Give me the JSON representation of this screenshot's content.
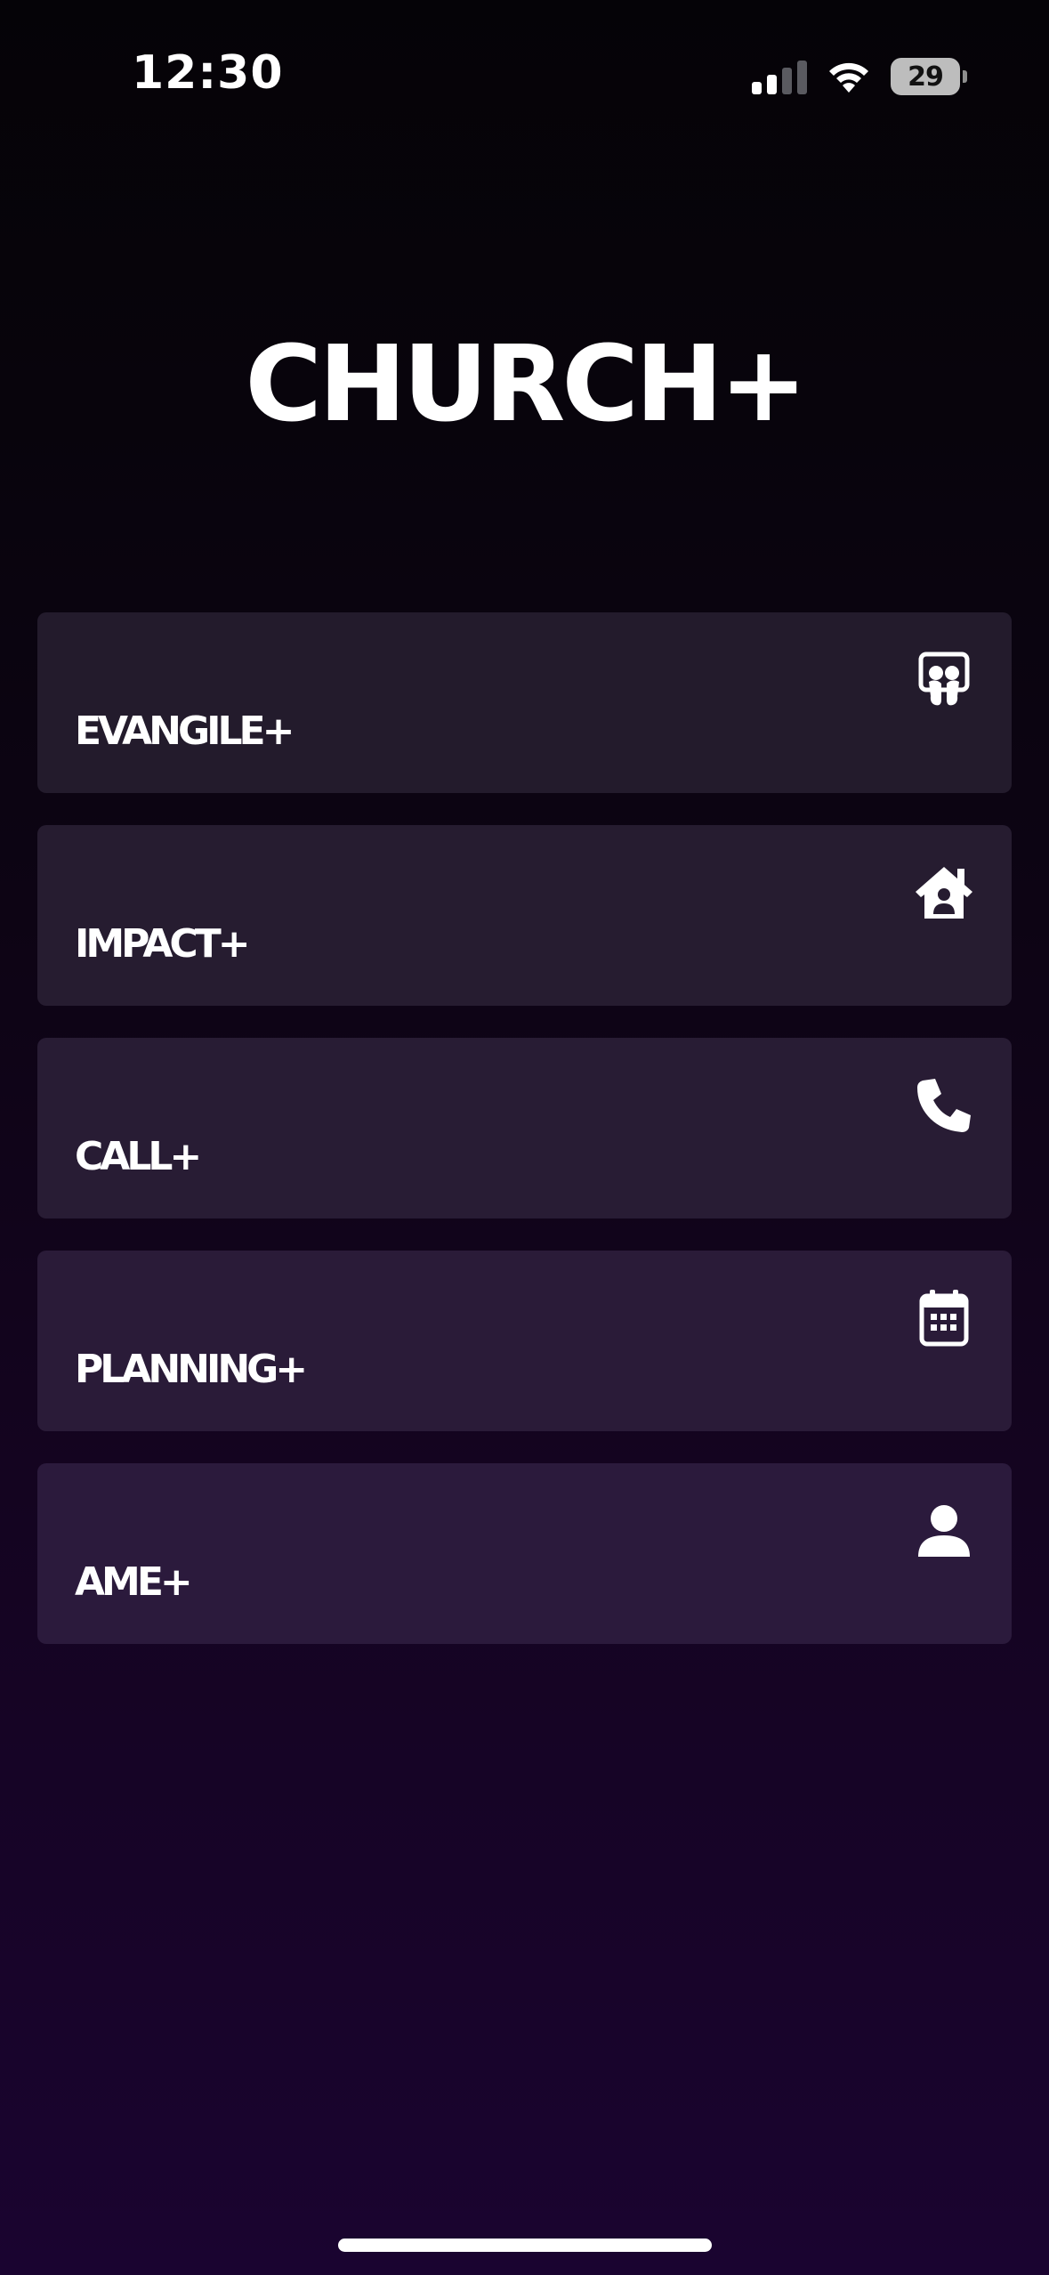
{
  "status_bar": {
    "time": "12:30",
    "battery_level": "29",
    "signal_icon": "cellular-signal-icon",
    "wifi_icon": "wifi-icon",
    "battery_icon": "battery-icon"
  },
  "app": {
    "title": "CHURCH+"
  },
  "menu": {
    "items": [
      {
        "label": "EVANGILE+",
        "icon": "slideshare-icon",
        "color": "#231b2c"
      },
      {
        "label": "IMPACT+",
        "icon": "house-user-icon",
        "color": "#261c30"
      },
      {
        "label": "CALL+",
        "icon": "phone-icon",
        "color": "#281c34"
      },
      {
        "label": "PLANNING+",
        "icon": "calendar-icon",
        "color": "#2a1b38"
      },
      {
        "label": "AME+",
        "icon": "user-icon",
        "color": "#2b1a3c"
      }
    ]
  },
  "colors": {
    "background_top": "#050307",
    "background_bottom": "#1a0430",
    "text": "#ffffff"
  }
}
